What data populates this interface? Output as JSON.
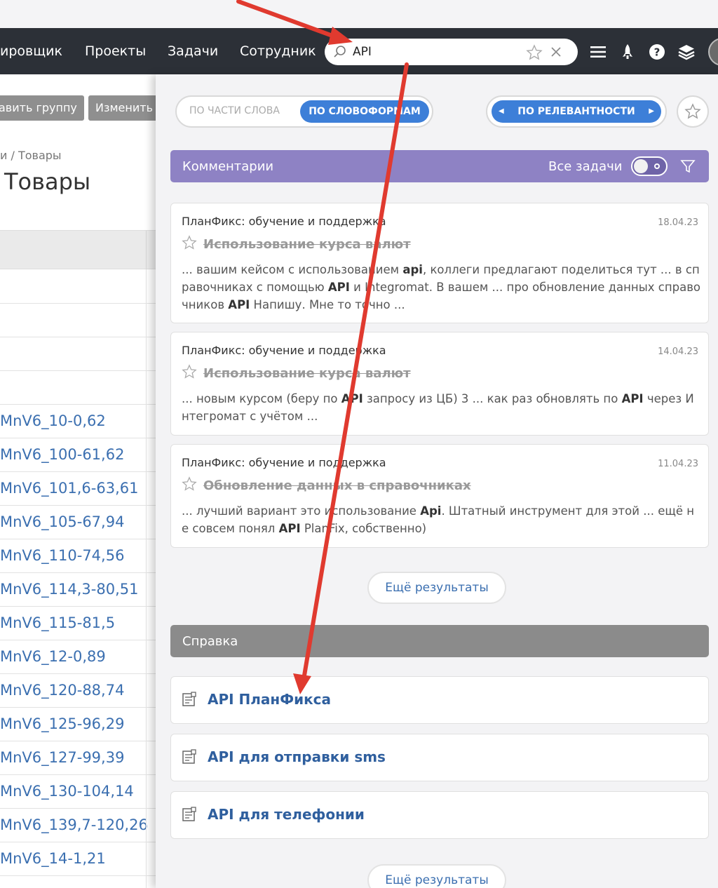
{
  "nav": {
    "items": [
      "ировщик",
      "Проекты",
      "Задачи",
      "Сотрудник"
    ],
    "search_value": "API"
  },
  "left_page": {
    "buttons": [
      "авить группу",
      "Изменить"
    ],
    "breadcrumb": "и / Товары",
    "title": "Товары",
    "rows": [
      "MnV6_10-0,62",
      "MnV6_100-61,62",
      "MnV6_101,6-63,61",
      "MnV6_105-67,94",
      "MnV6_110-74,56",
      "MnV6_114,3-80,51",
      "MnV6_115-81,5",
      "MnV6_12-0,89",
      "MnV6_120-88,74",
      "MnV6_125-96,29",
      "MnV6_127-99,39",
      "MnV6_130-104,14",
      "MnV6_139,7-120,26",
      "MnV6_14-1,21"
    ]
  },
  "search_panel": {
    "mode_partial": "ПО ЧАСТИ СЛОВА",
    "mode_wordforms": "ПО СЛОВОФОРМАМ",
    "sort_label": "ПО РЕЛЕВАНТНОСТИ",
    "comments": {
      "header": "Комментарии",
      "all_tasks_label": "Все задачи",
      "results": [
        {
          "source": "ПланФикс: обучение и поддержка",
          "date": "18.04.23",
          "title": "Использование курса валют",
          "snippet_html": "... вашим кейсом с использованием <b>api</b>, коллеги предлагают поделиться тут ... в справочниках с помощью <b>API</b> и Integromat. В вашем ... про обновление данных справочников <b>API</b> Напишу. Мне то точно ..."
        },
        {
          "source": "ПланФикс: обучение и поддержка",
          "date": "14.04.23",
          "title": "Использование курса валют",
          "snippet_html": "... новым курсом (беру по <b>API</b> запросу из ЦБ) 3 ... как раз обновлять по <b>API</b> через Интегромат с учётом ..."
        },
        {
          "source": "ПланФикс: обучение и поддержка",
          "date": "11.04.23",
          "title": "Обновление данных в справочниках",
          "snippet_html": "... лучший вариант это использование <b>Api</b>. Штатный инструмент для этой ... ещё не совсем понял <b>API</b> PlanFix, собственно)"
        }
      ],
      "more_label": "Ещё результаты"
    },
    "help": {
      "header": "Справка",
      "items": [
        "API ПланФикса",
        "API для отправки sms",
        "API для телефонии"
      ],
      "more_label": "Ещё результаты"
    }
  },
  "colors": {
    "navbar": "#2c3037",
    "accent_blue": "#3d7fd8",
    "comments_header": "#8e82c4",
    "help_header": "#8b8b8b",
    "link": "#3b6fb0",
    "annotation_arrow": "#e03a2f"
  },
  "icons": [
    "search-icon",
    "star-icon",
    "close-icon",
    "menu-icon",
    "rocket-icon",
    "help-icon",
    "layers-icon",
    "filter-icon",
    "document-icon"
  ]
}
